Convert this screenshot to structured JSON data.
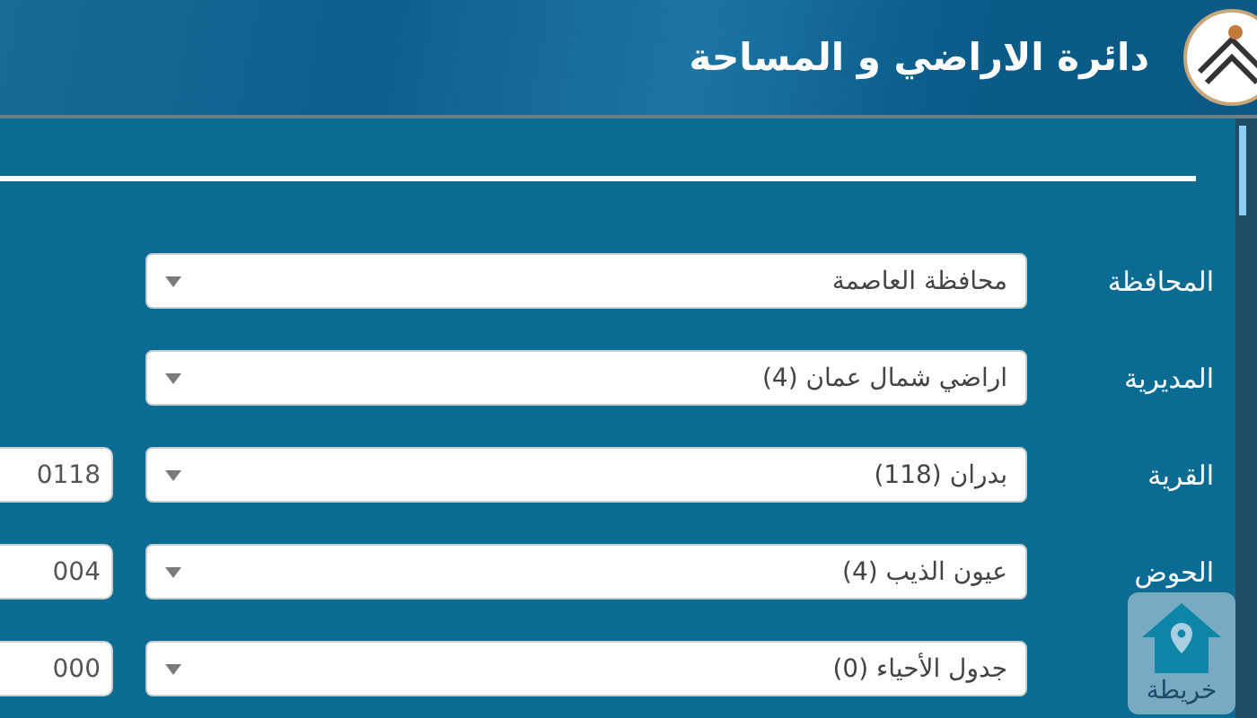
{
  "header": {
    "title": "دائرة الاراضي و المساحة"
  },
  "fields": [
    {
      "label": "المحافظة",
      "value": "محافظة العاصمة"
    },
    {
      "label": "المديرية",
      "value": "اراضي شمال عمان (4)"
    },
    {
      "label": "القرية",
      "value": "بدران (118)",
      "code": "0118"
    },
    {
      "label": "الحوض",
      "value": "عيون الذيب (4)",
      "code": "004"
    },
    {
      "value": "جدول الأحياء (0)",
      "code": "000"
    }
  ],
  "map_button": {
    "label": "خريطة"
  }
}
